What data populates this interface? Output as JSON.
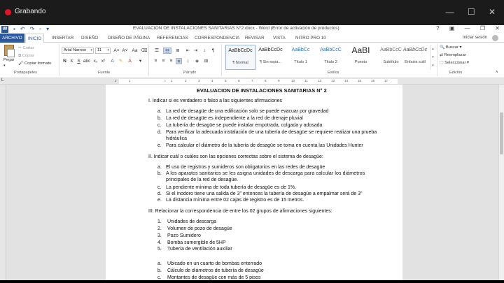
{
  "recording": {
    "label": "Grabando"
  },
  "word": {
    "title": "EVALUACION DE INSTALACIONES SANITARIAS N°2.docx - Word (Error de activación de productos)",
    "tabs": [
      "ARCHIVO",
      "INICIO",
      "INSERTAR",
      "DISEÑO",
      "DISEÑO DE PÁGINA",
      "REFERENCIAS",
      "CORRESPONDENCIA",
      "REVISAR",
      "VISTA",
      "NITRO PRO 10"
    ],
    "active_tab": "INICIO",
    "signin": "Iniciar sesión",
    "clipboard": {
      "paste": "Pegar",
      "cut": "Cortar",
      "copy": "Copiar",
      "format_painter": "Copiar formato",
      "label": "Portapapeles"
    },
    "font": {
      "family": "Arial Narrow",
      "size": "11",
      "label": "Fuente"
    },
    "paragraph": {
      "label": "Párrafo"
    },
    "styles": {
      "label": "Estilos",
      "items": [
        {
          "preview": "AaBbCcDc",
          "name": "¶ Normal"
        },
        {
          "preview": "AaBbCcDc",
          "name": "¶ Sin espa..."
        },
        {
          "preview": "AaBbCc",
          "name": "Título 1"
        },
        {
          "preview": "AaBbCcC",
          "name": "Título 2"
        },
        {
          "preview": "AaBI",
          "name": "Puesto"
        },
        {
          "preview": "AaBbCcC",
          "name": "Subtítulo"
        },
        {
          "preview": "AaBbCcDc",
          "name": "Énfasis sutil"
        }
      ]
    },
    "editing": {
      "find": "Buscar",
      "replace": "Reemplazar",
      "select": "Seleccionar",
      "label": "Edición"
    },
    "ruler_numbers": [
      "2",
      "1",
      "1",
      "2",
      "3",
      "4",
      "5",
      "6",
      "7",
      "8",
      "9",
      "10",
      "11",
      "12",
      "13",
      "14",
      "15",
      "16",
      "17"
    ]
  },
  "document": {
    "title": "EVALUACION DE INSTALACIONES SANITARIAS N° 2",
    "section1": {
      "heading": "I. Indicar si es verdadero o falso a las siguientes afirmaciones",
      "items": [
        {
          "marker": "a.",
          "text": "La red de desagüe de una edificación solo se puede evacuar por gravedad"
        },
        {
          "marker": "b.",
          "text": "La red de desagüe es independiente a la red de drenaje pluvial"
        },
        {
          "marker": "c.",
          "text": "La tubería de desagüe se puede instalar empotrada, colgada y adosada"
        },
        {
          "marker": "d.",
          "text": "Para verificar la adecuada instalación de una tubería de desagüe se requiere realizar una prueba"
        },
        {
          "marker": "",
          "text": "hidráulica"
        },
        {
          "marker": "e.",
          "text": "Para calcular el diámetro de la tubería de desagüe se toma en cuenta las Unidades Hunter"
        }
      ]
    },
    "section2": {
      "heading": "II. Indicar cuál o cuáles son las opciones correctas sobre el sistema de desagüe:",
      "items": [
        {
          "marker": "a.",
          "text": "El uso de registros y sumideros son obligatorios en las redes de desagüe"
        },
        {
          "marker": "b.",
          "text": "A los aparatos sanitarios se les asigna unidades de descarga para calcular los diámetros"
        },
        {
          "marker": "",
          "text": "principales de la red de desagüe."
        },
        {
          "marker": "c.",
          "text": "La pendiente mínima de toda tubería de desagüe es de 1%."
        },
        {
          "marker": "d.",
          "text": "Si el inodoro tiene una salida de 3\" entonces la tubería de desagüe a empalmar será de 3\""
        },
        {
          "marker": "e.",
          "text": "La distancia mínima entre 02 cajas de registro es de 15 metros."
        }
      ]
    },
    "section3": {
      "heading": "III. Relacionar la correspondencia de entre los 02 grupos de afirmaciones siguientes:",
      "numbered": [
        {
          "marker": "1.",
          "text": "Unidades de descarga"
        },
        {
          "marker": "2.",
          "text": "Volumen de pozo de desagüe"
        },
        {
          "marker": "3.",
          "text": "Pozo Sumidero"
        },
        {
          "marker": "4.",
          "text": "Bomba sumergible de 5HP"
        },
        {
          "marker": "5.",
          "text": "Tubería de ventilación auxiliar"
        }
      ],
      "lettered": [
        {
          "marker": "a.",
          "text": "Ubicado en un cuarto de bombas enterrado"
        },
        {
          "marker": "b.",
          "text": "Cálculo de diámetros de tubería de desagüe"
        },
        {
          "marker": "c.",
          "text": "Montantes de desagüe con más de 5 pisos"
        }
      ]
    }
  }
}
